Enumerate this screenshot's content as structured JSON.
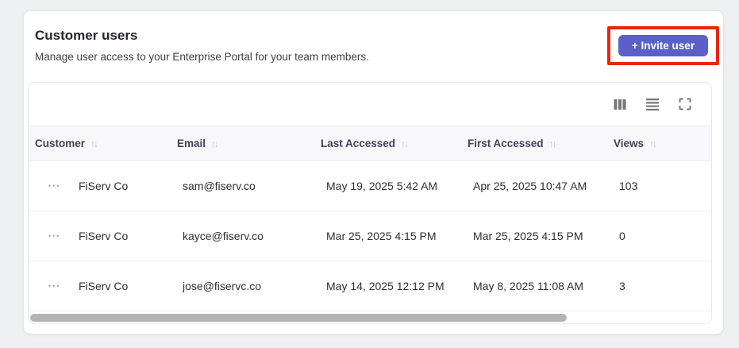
{
  "header": {
    "title": "Customer users",
    "subtitle": "Manage user access to your Enterprise Portal for your team members.",
    "invite_button": "+ Invite user"
  },
  "colors": {
    "accent": "#5a60c8",
    "annotation": "#e8250d"
  },
  "toolbar": {
    "icons": [
      "columns-icon",
      "density-icon",
      "fullscreen-icon"
    ]
  },
  "table": {
    "sort_glyph": "↑↓",
    "row_menu_glyph": "•••",
    "columns": [
      "Customer",
      "Email",
      "Last Accessed",
      "First Accessed",
      "Views"
    ],
    "rows": [
      {
        "customer": "FiServ Co",
        "email": "sam@fiserv.co",
        "last_accessed": "May 19, 2025 5:42 AM",
        "first_accessed": "Apr 25, 2025 10:47 AM",
        "views": "103"
      },
      {
        "customer": "FiServ Co",
        "email": "kayce@fiserv.co",
        "last_accessed": "Mar 25, 2025 4:15 PM",
        "first_accessed": "Mar 25, 2025 4:15 PM",
        "views": "0"
      },
      {
        "customer": "FiServ Co",
        "email": "jose@fiservc.co",
        "last_accessed": "May 14, 2025 12:12 PM",
        "first_accessed": "May 8, 2025 11:08 AM",
        "views": "3"
      }
    ]
  }
}
